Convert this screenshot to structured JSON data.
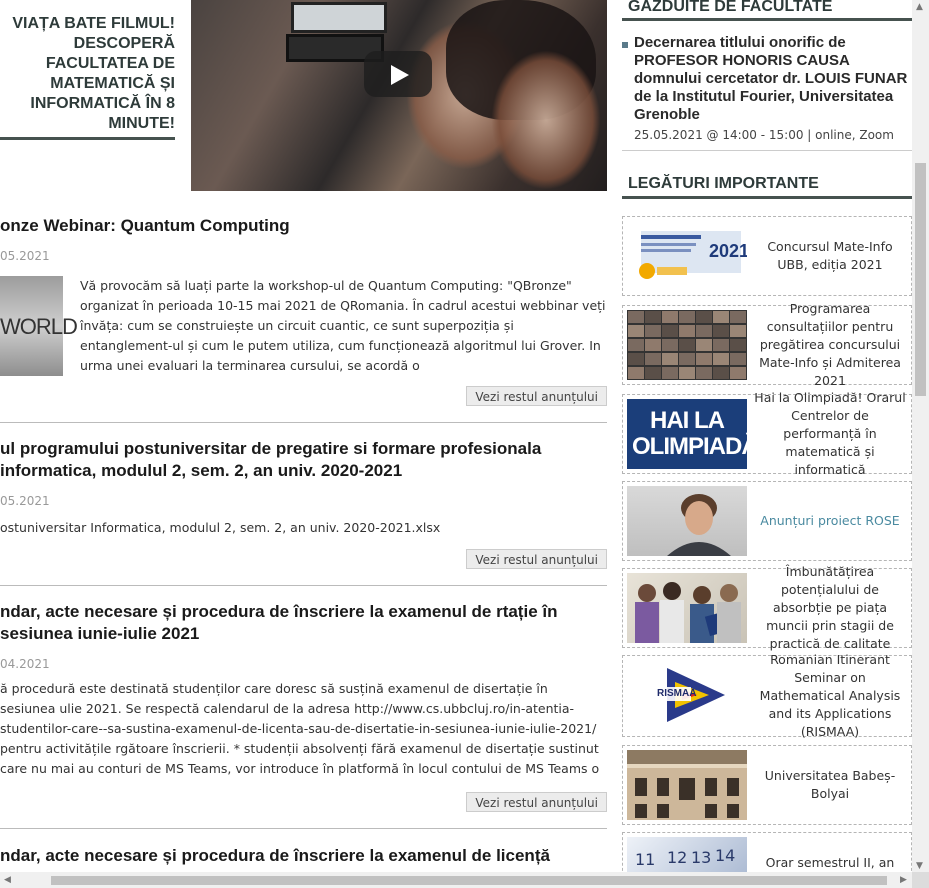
{
  "promo": {
    "text": "VIAȚA BATE FILMUL! DESCOPERĂ FACULTATEA DE MATEMATICĂ ȘI INFORMATICĂ ÎN 8 MINUTE!"
  },
  "news": [
    {
      "title": "onze Webinar: Quantum Computing",
      "date": "05.2021",
      "thumb_text": "WORLD",
      "body": "Vă provocăm să luați parte la workshop-ul de Quantum Computing: \"QBronze\" organizat în perioada 10-15  mai 2021 de QRomania. În cadrul acestui webbinar veți învăța: cum se construiește un circuit cuantic, ce sunt superpoziția și entanglement-ul și cum le putem utiliza, cum funcționează algoritmul lui Grover. In urma unei evaluari la terminarea cursului, se acordă o",
      "more": "Vezi restul anunțului"
    },
    {
      "title": "ul programului postuniversitar de pregatire si formare profesionala informatica, modulul 2, sem. 2, an univ. 2020-2021",
      "date": "05.2021",
      "body": "ostuniversitar Informatica, modulul 2, sem. 2, an univ. 2020-2021.xlsx",
      "more": "Vezi restul anunțului"
    },
    {
      "title": "ndar, acte necesare și procedura de înscriere la examenul de rtație în sesiunea iunie-iulie 2021",
      "date": "04.2021",
      "body": "ă procedură este destinată studenților care doresc să susțină examenul de disertație în sesiunea ulie 2021. Se respectă calendarul de la adresa http://www.cs.ubbcluj.ro/in-atentia-studentilor-care--sa-sustina-examenul-de-licenta-sau-de-disertatie-in-sesiunea-iunie-iulie-2021/ pentru activitățile rgătoare înscrierii. * studenții absolvenți fără examenul de disertație sustinut care nu mai au conturi de MS Teams, vor introduce în platformă în locul contului de MS Teams o",
      "more": "Vezi restul anunțului"
    },
    {
      "title": "ndar, acte necesare și procedura de înscriere la examenul de licență"
    }
  ],
  "sidebar": {
    "events_heading": "GAZDUITE DE FACULTATE",
    "event": {
      "title": "Decernarea titlului onorific de PROFESOR HONORIS CAUSA domnului cercetator dr. LOUIS FUNAR de la Institutul Fourier, Universitatea Grenoble",
      "meta": "25.05.2021 @ 14:00 - 15:00 | online, Zoom"
    },
    "links_heading": "LEGĂTURI IMPORTANTE",
    "links": [
      {
        "text": "Concursul Mate-Info UBB, ediția 2021",
        "icon": "mate-info-2021-banner"
      },
      {
        "text": "Programarea consultațiilor pentru pregătirea concursului Mate-Info și Admiterea 2021",
        "icon": "video-call-grid"
      },
      {
        "text": "Hai la Olimpiadă! Orarul Centrelor de performanță în matematică și informatică",
        "icon": "hai-la-olimpiada-banner",
        "img_text": "HAI LA OLIMPIADĂ!"
      },
      {
        "text": "Anunțuri proiect ROSE",
        "icon": "student-portrait"
      },
      {
        "text": "Îmbunătățirea potențialului de absorbție pe piața muncii prin stagii de practică de calitate",
        "icon": "students-photo"
      },
      {
        "text": "Romanian Itinerant Seminar on Mathematical Analysis and its Applications (RISMAA)",
        "icon": "rismaa-logo",
        "img_text": "RISMAA"
      },
      {
        "text": "Universitatea Babeș-Bolyai",
        "icon": "university-building"
      },
      {
        "text": "Orar semestrul II, an univ.",
        "icon": "calendar-photo"
      }
    ]
  },
  "colors": {
    "accent": "#46524f",
    "link": "#4a8aa0",
    "btn_bg": "#ececec"
  }
}
